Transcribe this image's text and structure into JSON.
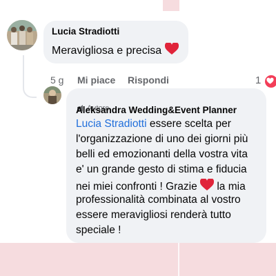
{
  "comment": {
    "author": "Lucia Stradiotti",
    "text": "Meravigliosa e precisa",
    "time": "5 g",
    "like_label": "Mi piace",
    "reply_label": "Rispondi",
    "reaction_count": "1",
    "reaction_color": "#f33e58"
  },
  "reply": {
    "badge": "Autore",
    "author": "Aleksandra Wedding&Event Planner",
    "mention": "Lucia Stradiotti",
    "line1_rest": " essere scelta per",
    "line2": "l'organizzazione di uno dei giorni più",
    "line3": "belli ed emozionanti della vostra vita",
    "line4": "e' un grande gesto di stima e fiducia",
    "line5a": "nei miei confronti ! Grazie ",
    "line5b": " la mia",
    "line6": "professionalità combinata al vostro",
    "line7": "essere meravigliosi renderà tutto",
    "line8": "speciale !"
  },
  "colors": {
    "background": "#f6dcdf",
    "bubble": "#f0f2f5",
    "mention": "#216fdb",
    "heart": "#e0243a"
  }
}
